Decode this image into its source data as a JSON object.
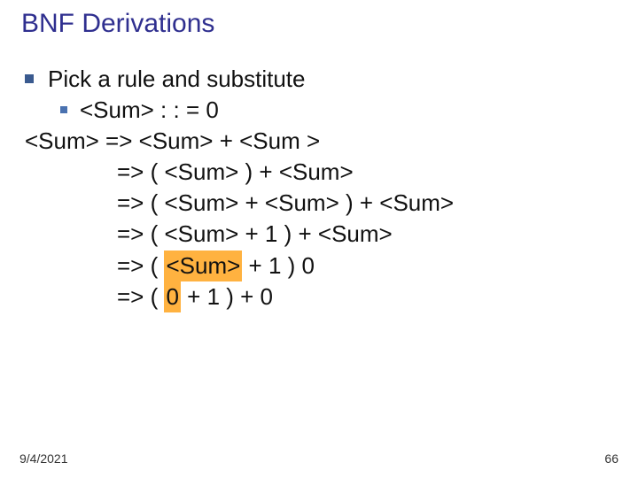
{
  "title": "BNF Derivations",
  "bullet_main": "Pick a rule and substitute",
  "bullet_sub": "<Sum> : : = 0",
  "deriv": {
    "l1": "<Sum> => <Sum> + <Sum >",
    "l2": "=> ( <Sum> ) + <Sum>",
    "l3": "=> ( <Sum> + <Sum> ) + <Sum>",
    "l4": "=> ( <Sum> + 1 ) + <Sum>",
    "l5a": "=> ( ",
    "l5b": "<Sum>",
    "l5c": " + 1 ) 0",
    "l6a": "=> ( ",
    "l6b": "0",
    "l6c": " + 1 ) + 0"
  },
  "footer_date": "9/4/2021",
  "footer_page": "66"
}
